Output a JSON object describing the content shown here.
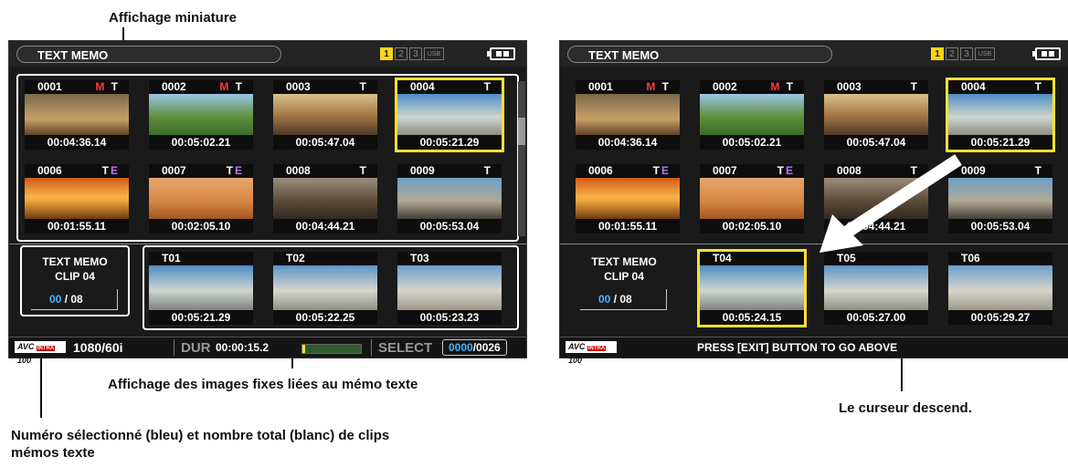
{
  "callouts": {
    "thumbnail_display": "Affichage miniature",
    "still_images": "Affichage des images fixes liées au mémo texte",
    "clip_number_line1": "Numéro sélectionné (bleu) et nombre total (blanc) de clips",
    "clip_number_line2": "mémos texte",
    "cursor_down": "Le curseur descend."
  },
  "colors": {
    "selection": "#ffe030",
    "selected_number": "#4ab3ff",
    "flag_m": "#ff3a3a",
    "flag_e": "#c070ff"
  },
  "left_screen": {
    "title": "TEXT MEMO",
    "tabs": [
      "1",
      "2",
      "3",
      "USB"
    ],
    "active_tab": "1",
    "battery_icon": "battery-icon",
    "thumbnails": [
      {
        "num": "0001",
        "flags": "M T",
        "tc": "00:04:36.14",
        "selected": false
      },
      {
        "num": "0002",
        "flags": "M T",
        "tc": "00:05:02.21",
        "selected": false
      },
      {
        "num": "0003",
        "flags": "T",
        "tc": "00:05:47.04",
        "selected": false
      },
      {
        "num": "0004",
        "flags": "T",
        "tc": "00:05:21.29",
        "selected": true
      },
      {
        "num": "0006",
        "flags": "TE",
        "tc": "00:01:55.11",
        "selected": false
      },
      {
        "num": "0007",
        "flags": "TE",
        "tc": "00:02:05.10",
        "selected": false
      },
      {
        "num": "0008",
        "flags": "T",
        "tc": "00:04:44.21",
        "selected": false
      },
      {
        "num": "0009",
        "flags": "T",
        "tc": "00:05:53.04",
        "selected": false
      }
    ],
    "memo_title_line1": "TEXT MEMO",
    "memo_title_line2": "CLIP 04",
    "memo_current": "00",
    "memo_total": " / 08",
    "memos": [
      {
        "label": "T01",
        "tc": "00:05:21.29"
      },
      {
        "label": "T02",
        "tc": "00:05:22.25"
      },
      {
        "label": "T03",
        "tc": "00:05:23.23"
      }
    ],
    "format": "1080/60i",
    "dur_label": "DUR",
    "dur_value": "00:00:15.2",
    "select_label": "SELECT",
    "select_current": "0000",
    "select_total": "/0026",
    "codec_logo": "AVC-Intra 100"
  },
  "right_screen": {
    "title": "TEXT MEMO",
    "tabs": [
      "1",
      "2",
      "3",
      "USB"
    ],
    "active_tab": "1",
    "thumbnails": [
      {
        "num": "0001",
        "flags": "M T",
        "tc": "00:04:36.14",
        "selected": false
      },
      {
        "num": "0002",
        "flags": "M T",
        "tc": "00:05:02.21",
        "selected": false
      },
      {
        "num": "0003",
        "flags": "T",
        "tc": "00:05:47.04",
        "selected": false
      },
      {
        "num": "0004",
        "flags": "T",
        "tc": "00:05:21.29",
        "selected": true
      },
      {
        "num": "0006",
        "flags": "TE",
        "tc": "00:01:55.11",
        "selected": false
      },
      {
        "num": "0007",
        "flags": "TE",
        "tc": "00:02:05.10",
        "selected": false
      },
      {
        "num": "0008",
        "flags": "T",
        "tc": "00:04:44.21",
        "selected": false
      },
      {
        "num": "0009",
        "flags": "T",
        "tc": "00:05:53.04",
        "selected": false
      }
    ],
    "memo_title_line1": "TEXT MEMO",
    "memo_title_line2": "CLIP 04",
    "memo_current": "00",
    "memo_total": " / 08",
    "memos": [
      {
        "label": "T04",
        "tc": "00:05:24.15",
        "selected": true
      },
      {
        "label": "T05",
        "tc": "00:05:27.00",
        "selected": false
      },
      {
        "label": "T06",
        "tc": "00:05:29.27",
        "selected": false
      }
    ],
    "message": "PRESS [EXIT] BUTTON TO GO ABOVE",
    "codec_logo": "AVC-Intra 100"
  }
}
